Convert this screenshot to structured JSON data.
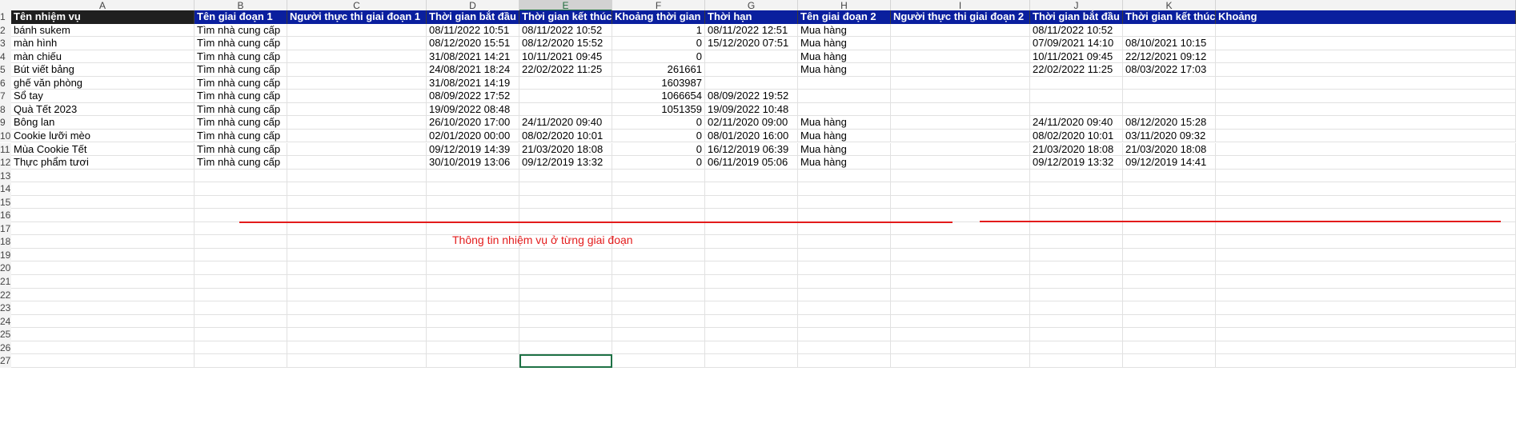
{
  "columns": [
    "A",
    "B",
    "C",
    "D",
    "E",
    "F",
    "G",
    "H",
    "I",
    "J",
    "K",
    ""
  ],
  "selected_column": "E",
  "row_numbers": [
    "1",
    "2",
    "3",
    "4",
    "5",
    "6",
    "7",
    "8",
    "9",
    "10",
    "11",
    "12",
    "13",
    "14",
    "15",
    "16",
    "17",
    "18",
    "19",
    "20",
    "21",
    "22",
    "23",
    "24",
    "25",
    "26",
    "27"
  ],
  "header": [
    "Tên nhiệm vụ",
    "Tên giai đoạn 1",
    "Người thực thi giai đoạn 1",
    "Thời gian bắt đầu",
    "Thời gian kết thúc",
    "Khoảng thời gian",
    "Thời hạn",
    "Tên giai đoạn 2",
    "Người thực thi giai đoạn 2",
    "Thời gian bắt đầu",
    "Thời gian kết thúc",
    "Khoảng"
  ],
  "rows": [
    [
      "bánh sukem",
      "Tìm nhà cung cấp",
      "",
      "08/11/2022 10:51",
      "08/11/2022 10:52",
      "1",
      "08/11/2022 12:51",
      "Mua hàng",
      "",
      "08/11/2022 10:52",
      "",
      ""
    ],
    [
      "màn hình",
      "Tìm nhà cung cấp",
      "",
      "08/12/2020 15:51",
      "08/12/2020 15:52",
      "0",
      "15/12/2020 07:51",
      "Mua hàng",
      "",
      "07/09/2021 14:10",
      "08/10/2021 10:15",
      ""
    ],
    [
      "màn chiếu",
      "Tìm nhà cung cấp",
      "",
      "31/08/2021 14:21",
      "10/11/2021 09:45",
      "0",
      "",
      "Mua hàng",
      "",
      "10/11/2021 09:45",
      "22/12/2021 09:12",
      ""
    ],
    [
      "Bút viết bảng",
      "Tìm nhà cung cấp",
      "",
      "24/08/2021 18:24",
      "22/02/2022 11:25",
      "261661",
      "",
      "Mua hàng",
      "",
      "22/02/2022 11:25",
      "08/03/2022 17:03",
      ""
    ],
    [
      "ghế văn phòng",
      "Tìm nhà cung cấp",
      "",
      "31/08/2021 14:19",
      "",
      "1603987",
      "",
      "",
      "",
      "",
      "",
      ""
    ],
    [
      "Sổ tay",
      "Tìm nhà cung cấp",
      "",
      "08/09/2022 17:52",
      "",
      "1066654",
      "08/09/2022 19:52",
      "",
      "",
      "",
      "",
      ""
    ],
    [
      "Quà Tết 2023",
      "Tìm nhà cung cấp",
      "",
      "19/09/2022 08:48",
      "",
      "1051359",
      "19/09/2022 10:48",
      "",
      "",
      "",
      "",
      ""
    ],
    [
      "Bông lan",
      "Tìm nhà cung cấp",
      "",
      "26/10/2020 17:00",
      "24/11/2020 09:40",
      "0",
      "02/11/2020 09:00",
      "Mua hàng",
      "",
      "24/11/2020 09:40",
      "08/12/2020 15:28",
      ""
    ],
    [
      "Cookie lưỡi mèo",
      "Tìm nhà cung cấp",
      "",
      "02/01/2020 00:00",
      "08/02/2020 10:01",
      "0",
      "08/01/2020 16:00",
      "Mua hàng",
      "",
      "08/02/2020 10:01",
      "03/11/2020 09:32",
      ""
    ],
    [
      "Mùa Cookie Tết",
      "Tìm nhà cung cấp",
      "",
      "09/12/2019 14:39",
      "21/03/2020 18:08",
      "0",
      "16/12/2019 06:39",
      "Mua hàng",
      "",
      "21/03/2020 18:08",
      "21/03/2020 18:08",
      ""
    ],
    [
      "Thực phẩm tươi",
      "Tìm nhà cung cấp",
      "",
      "30/10/2019 13:06",
      "09/12/2019 13:32",
      "0",
      "06/11/2019 05:06",
      "Mua hàng",
      "",
      "09/12/2019 13:32",
      "09/12/2019 14:41",
      ""
    ]
  ],
  "annotation": "Thông tin nhiệm vụ ở từng giai đoạn",
  "colors": {
    "header_dark": "#1f1f1f",
    "header_blue": "#0a1f9e",
    "annotation_red": "#e31b1b",
    "selection_green": "#1e7145"
  }
}
